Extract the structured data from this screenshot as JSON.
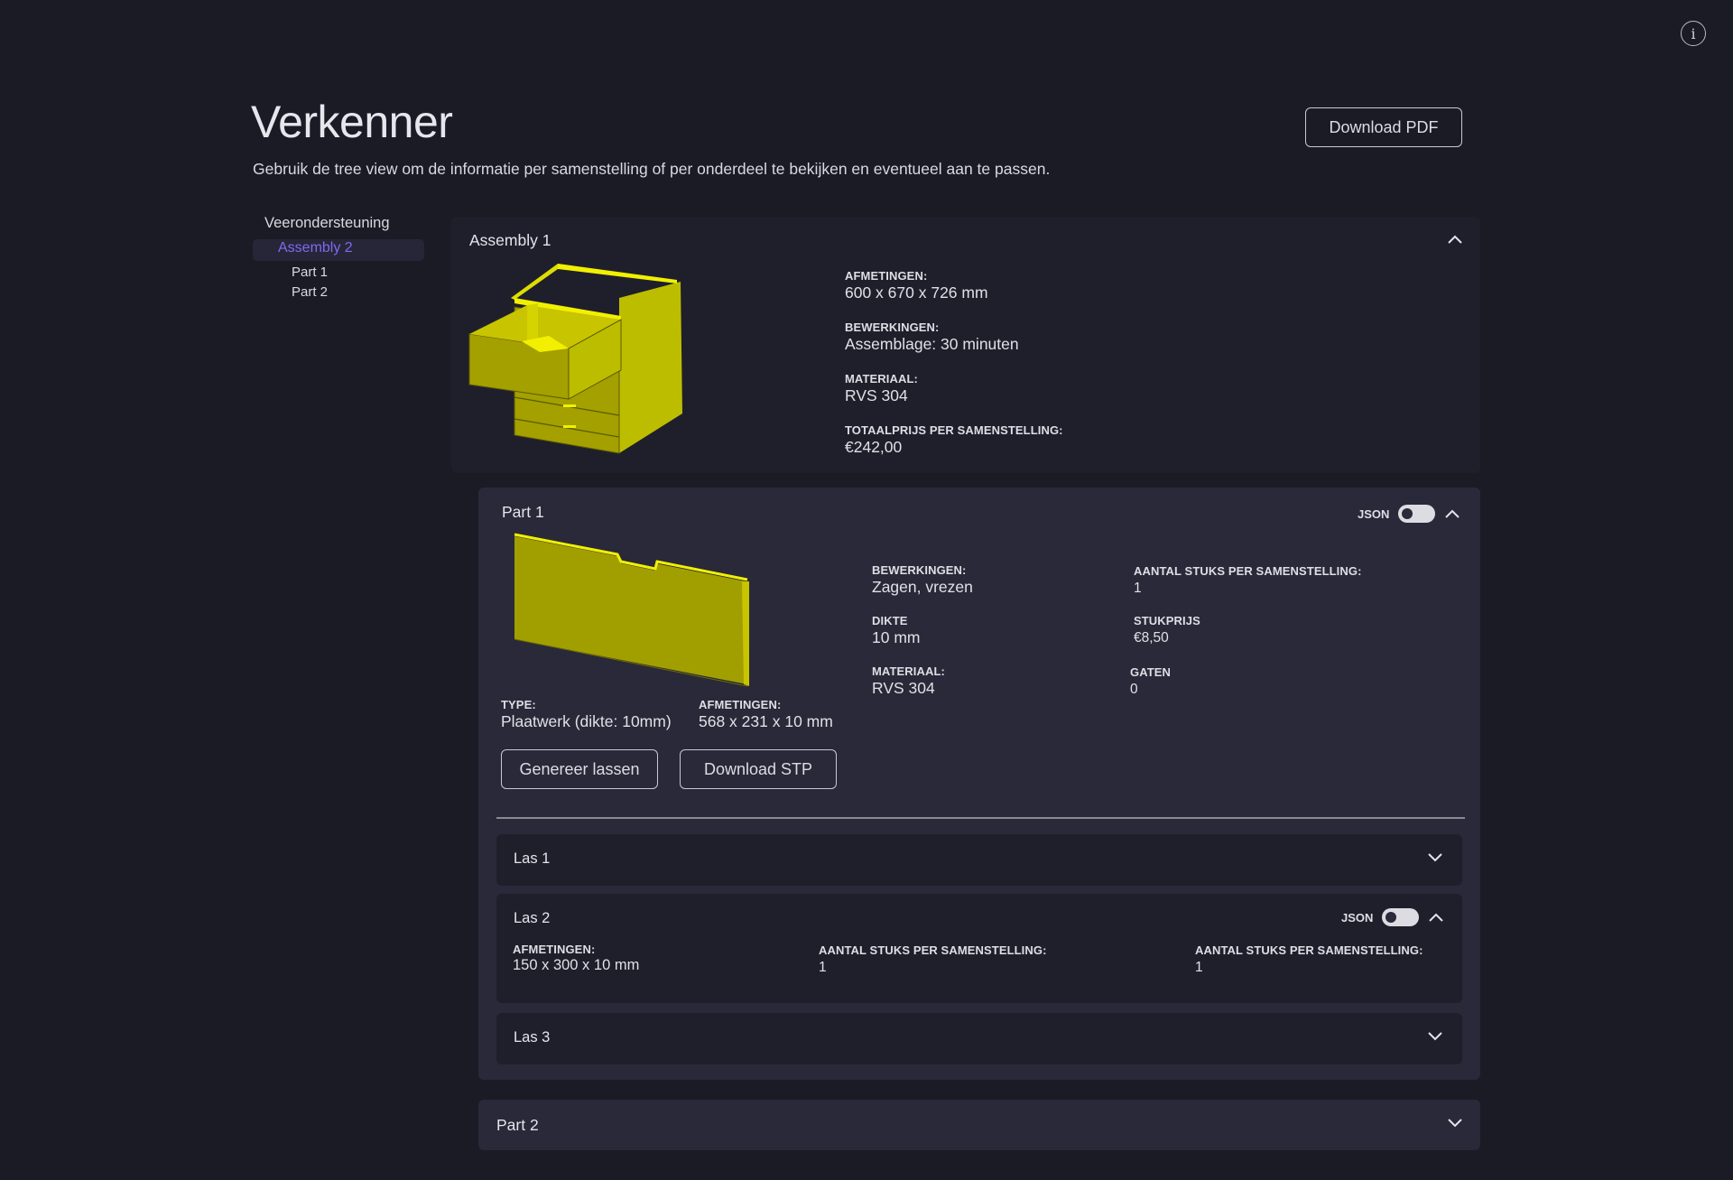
{
  "header": {
    "title": "Verkenner",
    "subtitle": "Gebruik de tree view om de informatie per samenstelling of per onderdeel te bekijken en eventueel aan te passen.",
    "download_pdf_label": "Download PDF",
    "info_icon": "i"
  },
  "sidebar": {
    "root": "Veerondersteuning",
    "selected": "Assembly 2",
    "children": [
      "Part 1",
      "Part 2"
    ],
    "selected_color": "#7b6cf0"
  },
  "assembly": {
    "title": "Assembly 1",
    "image": "drawer-cabinet-3d-model",
    "fields": [
      {
        "label": "AFMETINGEN:",
        "value": "600 x 670 x 726 mm"
      },
      {
        "label": "BEWERKINGEN:",
        "value": "Assemblage: 30 minuten"
      },
      {
        "label": "MATERIAAL:",
        "value": "RVS 304"
      },
      {
        "label": "TOTAALPRIJS PER SAMENSTELLING:",
        "value": "€242,00"
      }
    ]
  },
  "part1": {
    "title": "Part 1",
    "json_label": "JSON",
    "json_toggle_on": false,
    "image": "sheet-panel-3d-model",
    "type_label": "TYPE:",
    "type_value": "Plaatwerk (dikte: 10mm)",
    "dims_label": "AFMETINGEN:",
    "dims_value": "568 x 231 x 10 mm",
    "fields_left": [
      {
        "label": "BEWERKINGEN:",
        "value": "Zagen, vrezen"
      },
      {
        "label": "DIKTE",
        "value": "10 mm"
      },
      {
        "label": "MATERIAAL:",
        "value": "RVS 304"
      }
    ],
    "fields_right": [
      {
        "label": "AANTAL STUKS PER SAMENSTELLING:",
        "value": "1"
      },
      {
        "label": "STUKPRIJS",
        "value": "€8,50"
      },
      {
        "label": "GATEN",
        "value": "0"
      }
    ],
    "generate_welds_label": "Genereer lassen",
    "download_stp_label": "Download STP"
  },
  "welds": [
    {
      "title": "Las 1",
      "expanded": false
    },
    {
      "title": "Las 2",
      "expanded": true,
      "json_label": "JSON",
      "json_toggle_on": false,
      "fields": [
        {
          "label": "AFMETINGEN:",
          "value": "150 x 300 x 10 mm"
        },
        {
          "label": "AANTAL STUKS PER SAMENSTELLING:",
          "value": "1"
        },
        {
          "label": "AANTAL STUKS PER SAMENSTELLING:",
          "value": "1"
        }
      ]
    },
    {
      "title": "Las 3",
      "expanded": false
    }
  ],
  "part2": {
    "title": "Part 2",
    "expanded": false
  },
  "colors": {
    "background": "#1b1b26",
    "assembly_card": "#1f1f2c",
    "part_card": "#292939",
    "model_yellow": "#c8c400"
  }
}
